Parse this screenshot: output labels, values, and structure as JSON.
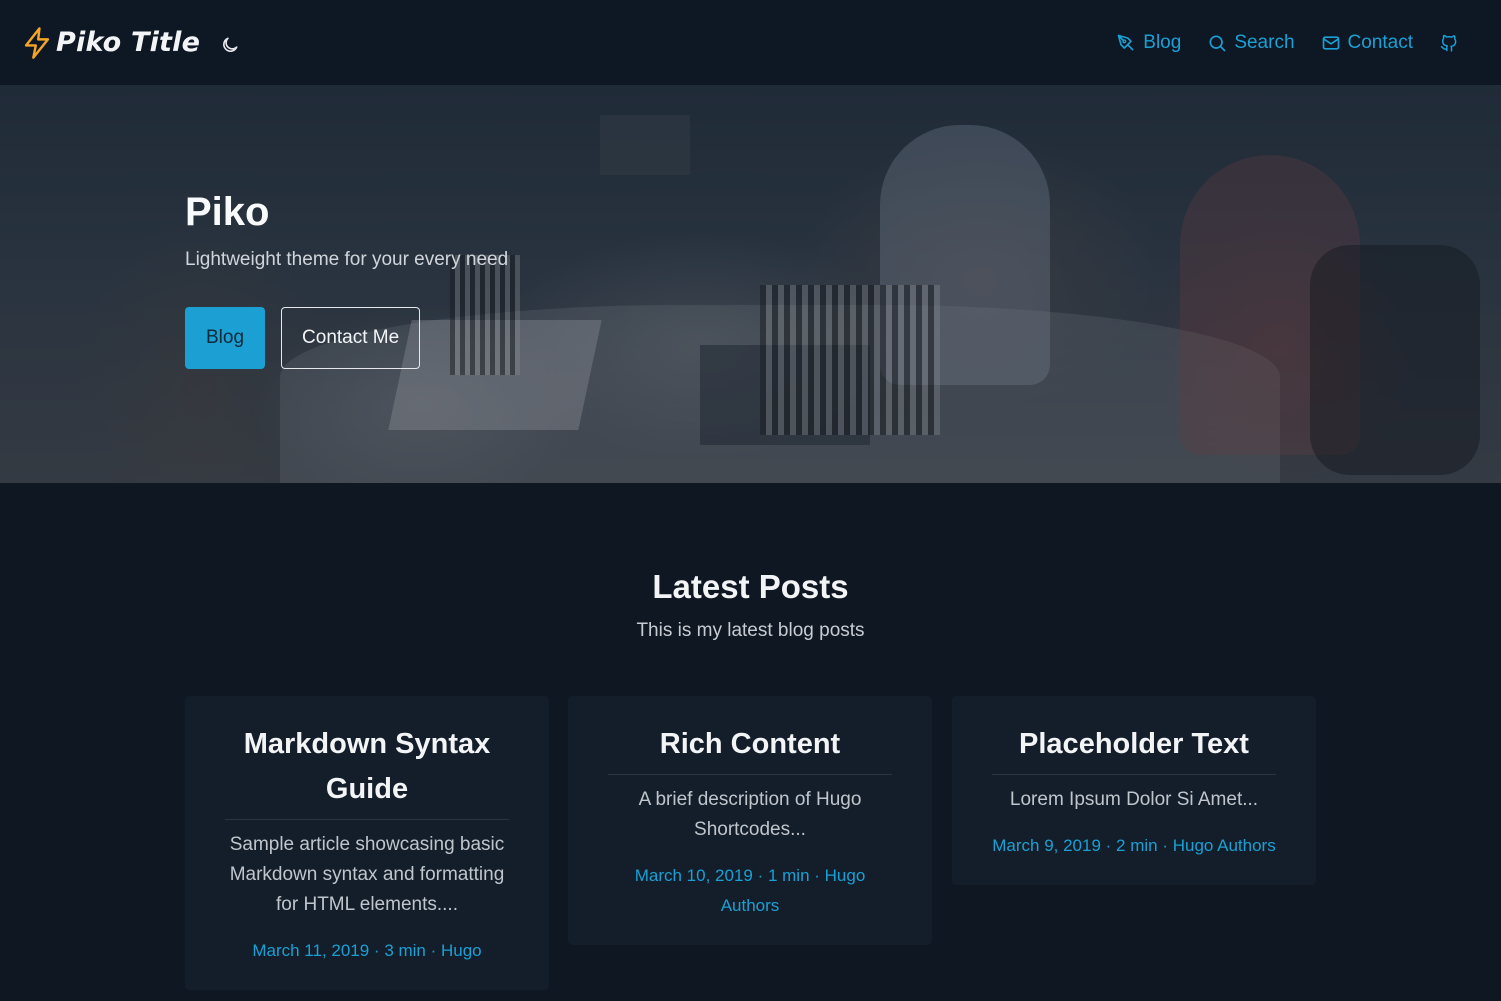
{
  "header": {
    "brand_title": "Piko Title",
    "nav": [
      {
        "label": "Blog",
        "icon": "pen-tool-icon"
      },
      {
        "label": "Search",
        "icon": "search-icon"
      },
      {
        "label": "Contact",
        "icon": "mail-icon"
      },
      {
        "label": "",
        "icon": "github-icon"
      }
    ]
  },
  "hero": {
    "title": "Piko",
    "subtitle": "Lightweight theme for your every need",
    "primary_button": "Blog",
    "secondary_button": "Contact Me"
  },
  "latest": {
    "title": "Latest Posts",
    "subtitle": "This is my latest blog posts",
    "posts": [
      {
        "title": "Markdown Syntax Guide",
        "description": "Sample article showcasing basic Markdown syntax and formatting for HTML elements....",
        "meta": "March 11, 2019 · 3 min · Hugo"
      },
      {
        "title": "Rich Content",
        "description": "A brief description of Hugo Shortcodes...",
        "meta": "March 10, 2019 · 1 min · Hugo Authors"
      },
      {
        "title": "Placeholder Text",
        "description": "Lorem Ipsum Dolor Si Amet...",
        "meta": "March 9, 2019 · 2 min · Hugo Authors"
      }
    ]
  },
  "colors": {
    "background": "#0f1722",
    "accent": "#1c9fd2",
    "brand_bolt": "#f5a524",
    "card": "#141e2a"
  }
}
